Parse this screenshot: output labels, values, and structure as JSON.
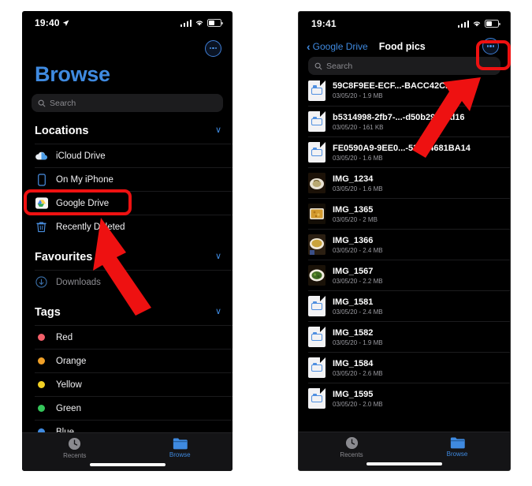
{
  "left_phone": {
    "status": {
      "time": "19:40",
      "location_arrow": "↗",
      "signal": "cellular-bars",
      "wifi": "wifi-icon",
      "battery": "battery-icon"
    },
    "more_button": "more-options",
    "title": "Browse",
    "search": {
      "placeholder": "Search",
      "icon": "search-icon"
    },
    "sections": [
      {
        "title": "Locations",
        "chevron": "∨",
        "items": [
          {
            "label": "iCloud Drive",
            "icon": "icloud-drive-icon"
          },
          {
            "label": "On My iPhone",
            "icon": "iphone-icon"
          },
          {
            "label": "Google Drive",
            "icon": "google-drive-icon",
            "highlighted": true
          },
          {
            "label": "Recently Deleted",
            "icon": "trash-icon"
          }
        ]
      },
      {
        "title": "Favourites",
        "chevron": "∨",
        "items": [
          {
            "label": "Downloads",
            "icon": "download-icon",
            "dim": true
          }
        ]
      },
      {
        "title": "Tags",
        "chevron": "∨",
        "items": [
          {
            "label": "Red",
            "icon": "tag-dot",
            "color": "#f2606a"
          },
          {
            "label": "Orange",
            "icon": "tag-dot",
            "color": "#f0a028"
          },
          {
            "label": "Yellow",
            "icon": "tag-dot",
            "color": "#f2d024"
          },
          {
            "label": "Green",
            "icon": "tag-dot",
            "color": "#34c65a"
          },
          {
            "label": "Blue",
            "icon": "tag-dot",
            "color": "#3f8ae0"
          }
        ]
      }
    ],
    "tabs": [
      {
        "label": "Recents",
        "icon": "clock-icon",
        "active": false
      },
      {
        "label": "Browse",
        "icon": "folder-icon",
        "active": true
      }
    ]
  },
  "right_phone": {
    "status": {
      "time": "19:41",
      "signal": "cellular-bars",
      "wifi": "wifi-icon",
      "battery": "battery-icon"
    },
    "nav": {
      "back_label": "Google Drive",
      "back_chevron": "‹",
      "title": "Food pics",
      "more_button": "more-options"
    },
    "search": {
      "placeholder": "Search",
      "icon": "search-icon"
    },
    "files": [
      {
        "name": "59C8F9EE-ECF...-BACC42CB5FA5",
        "sub": "03/05/20 - 1.9 MB",
        "icon": "document-icon"
      },
      {
        "name": "b5314998-2fb7-...-d50b2961ed16",
        "sub": "03/05/20 - 161 KB",
        "icon": "document-icon"
      },
      {
        "name": "FE0590A9-9EE0...-536C4681BA14",
        "sub": "03/05/20 - 1.6 MB",
        "icon": "document-icon"
      },
      {
        "name": "IMG_1234",
        "sub": "03/05/20 - 1.6 MB",
        "icon": "photo-thumbnail",
        "thumb": "plate"
      },
      {
        "name": "IMG_1365",
        "sub": "03/05/20 - 2 MB",
        "icon": "photo-thumbnail",
        "thumb": "rice"
      },
      {
        "name": "IMG_1366",
        "sub": "03/05/20 - 2.4 MB",
        "icon": "photo-thumbnail",
        "thumb": "bowl"
      },
      {
        "name": "IMG_1567",
        "sub": "03/05/20 - 2.2 MB",
        "icon": "photo-thumbnail",
        "thumb": "greens"
      },
      {
        "name": "IMG_1581",
        "sub": "03/05/20 - 2.4 MB",
        "icon": "document-icon"
      },
      {
        "name": "IMG_1582",
        "sub": "03/05/20 - 1.9 MB",
        "icon": "document-icon"
      },
      {
        "name": "IMG_1584",
        "sub": "03/05/20 - 2.6 MB",
        "icon": "document-icon"
      },
      {
        "name": "IMG_1595",
        "sub": "03/05/20 - 2.0 MB",
        "icon": "document-icon"
      }
    ],
    "tabs": [
      {
        "label": "Recents",
        "icon": "clock-icon",
        "active": false
      },
      {
        "label": "Browse",
        "icon": "folder-icon",
        "active": true
      }
    ]
  },
  "annotations": {
    "highlight_color": "#ee1111",
    "boxes": [
      {
        "name": "google-drive-highlight"
      },
      {
        "name": "more-button-highlight"
      }
    ],
    "arrows": [
      {
        "name": "arrow-to-google-drive"
      },
      {
        "name": "arrow-to-more-button"
      }
    ]
  },
  "colors": {
    "accent": "#3f8ae0",
    "background": "#000000",
    "page": "#ffffff"
  }
}
